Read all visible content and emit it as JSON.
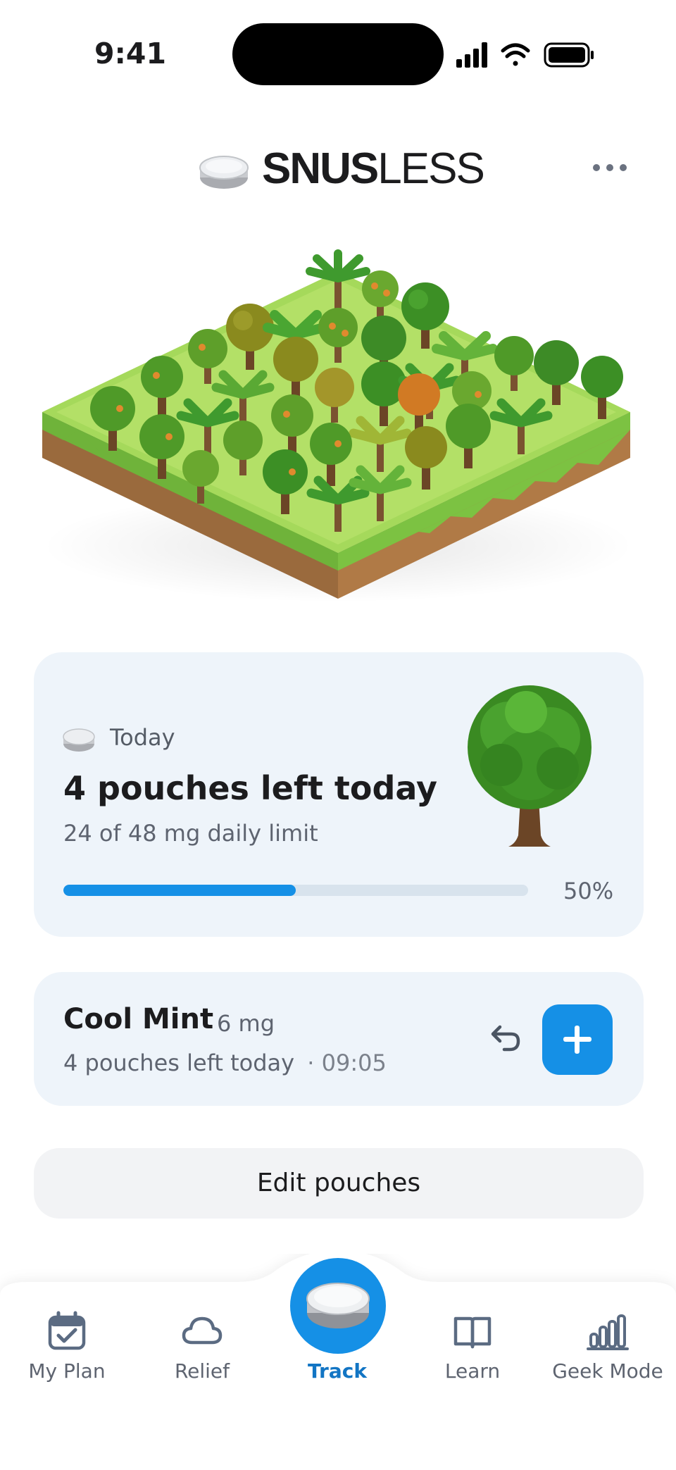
{
  "status_bar": {
    "time": "9:41"
  },
  "header": {
    "brand_bold": "SNUS",
    "brand_light": "LESS",
    "more_menu": "more-icon"
  },
  "today_card": {
    "label": "Today",
    "pouches_left": "4 pouches left today",
    "limit_text": "24 of 48 mg daily limit",
    "progress_fraction": 0.5,
    "progress_text": "50%"
  },
  "product_card": {
    "name": "Cool Mint",
    "strength": "6 mg",
    "subtitle": "4 pouches left today",
    "last_time": "· 09:05"
  },
  "edit_button": "Edit pouches",
  "tabs": [
    {
      "label": "My Plan",
      "icon": "calendar-check-icon"
    },
    {
      "label": "Relief",
      "icon": "cloud-icon"
    },
    {
      "label": "Track",
      "icon": "pouch-tin-icon",
      "active": true
    },
    {
      "label": "Learn",
      "icon": "book-icon"
    },
    {
      "label": "Geek Mode",
      "icon": "bar-chart-icon"
    }
  ],
  "colors": {
    "accent": "#1590e6",
    "card_bg": "#eef4fa",
    "active_tab": "#1275c4"
  }
}
